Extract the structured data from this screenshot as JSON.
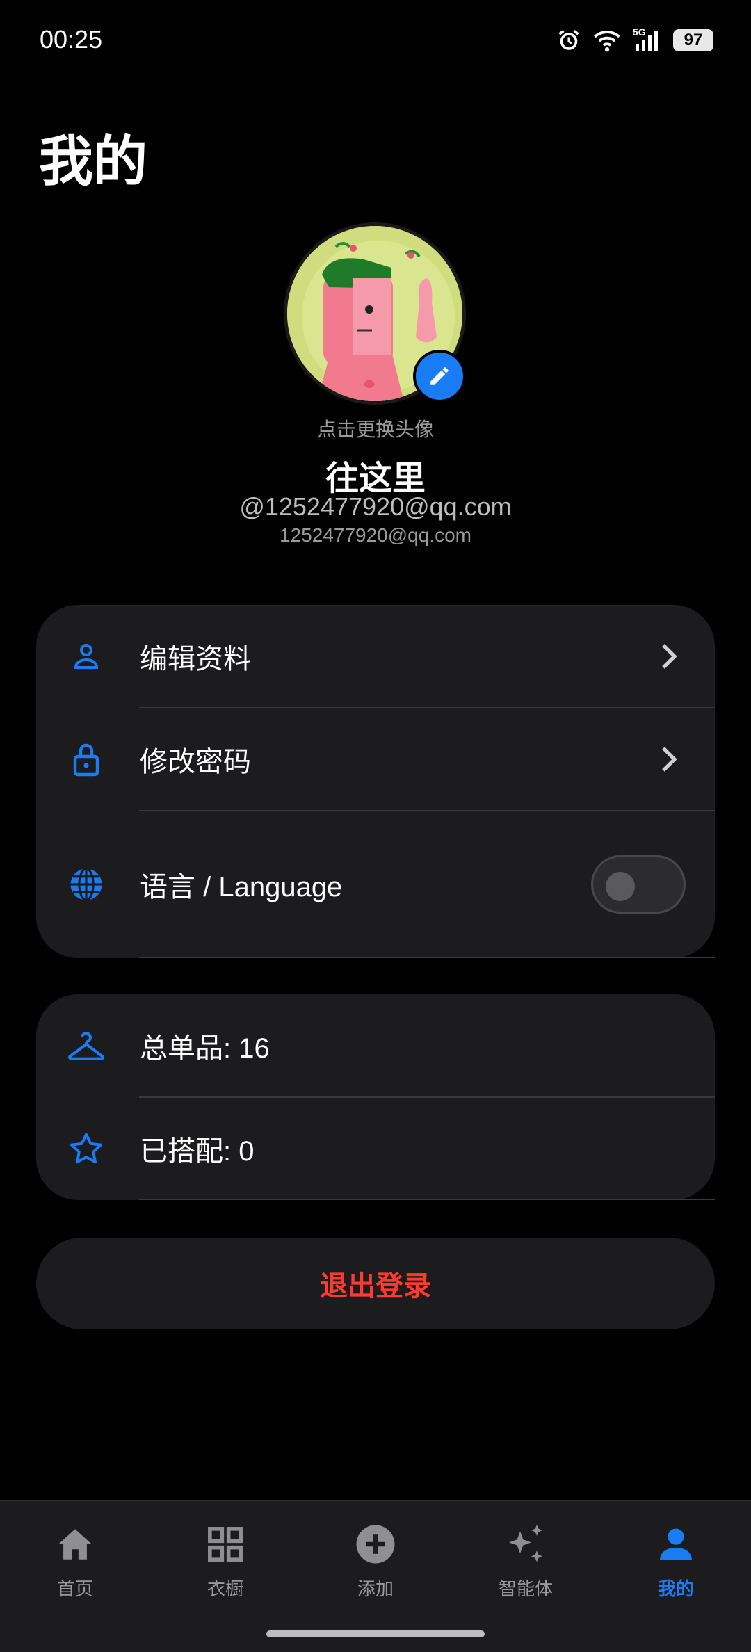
{
  "status_bar": {
    "time": "00:25",
    "network": "5G",
    "battery": "97"
  },
  "page": {
    "title": "我的"
  },
  "profile": {
    "avatar_hint": "点击更换头像",
    "name": "往这里",
    "handle": "@1252477920@qq.com",
    "email": "1252477920@qq.com"
  },
  "settings": {
    "items": [
      {
        "label": "编辑资料",
        "icon": "person-icon"
      },
      {
        "label": "修改密码",
        "icon": "lock-icon"
      },
      {
        "label": "语言 / Language",
        "icon": "globe-icon",
        "toggle_on": false
      }
    ]
  },
  "stats": {
    "items": [
      {
        "label": "总单品: 16",
        "icon": "hanger-icon"
      },
      {
        "label": "已搭配: 0",
        "icon": "star-icon"
      }
    ]
  },
  "logout": {
    "label": "退出登录"
  },
  "nav": {
    "items": [
      {
        "label": "首页",
        "icon": "home-icon"
      },
      {
        "label": "衣橱",
        "icon": "grid-icon"
      },
      {
        "label": "添加",
        "icon": "add-circle-icon"
      },
      {
        "label": "智能体",
        "icon": "sparkle-icon"
      },
      {
        "label": "我的",
        "icon": "person-icon",
        "active": true
      }
    ]
  },
  "colors": {
    "accent": "#1a7cf5",
    "danger": "#ff3b30",
    "card": "#1c1c1e",
    "background": "#000000"
  }
}
